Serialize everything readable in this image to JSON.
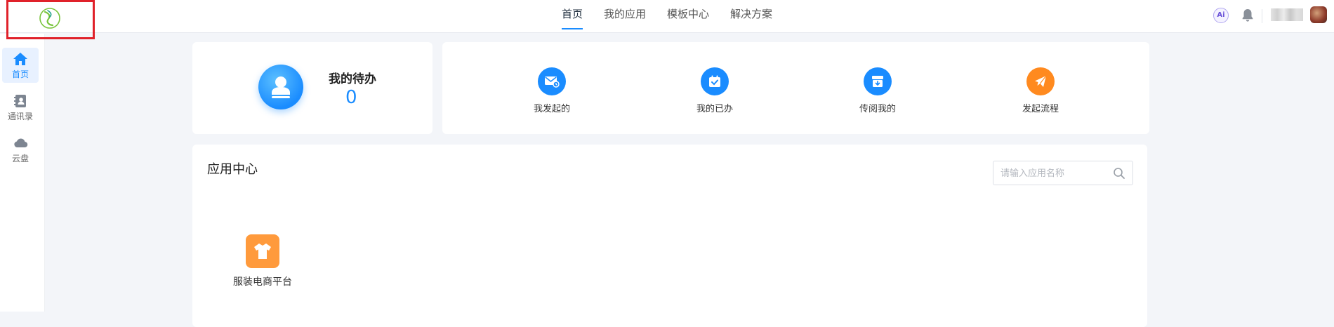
{
  "nav": {
    "items": [
      "首页",
      "我的应用",
      "模板中心",
      "解决方案"
    ],
    "active": 0
  },
  "header": {
    "ai_label": "Ai"
  },
  "sidebar": {
    "items": [
      {
        "label": "首页",
        "icon": "home-icon",
        "active": true
      },
      {
        "label": "通讯录",
        "icon": "contacts-icon"
      },
      {
        "label": "云盘",
        "icon": "cloud-icon"
      }
    ]
  },
  "todo": {
    "title": "我的待办",
    "count": "0"
  },
  "quick_actions": [
    {
      "label": "我发起的",
      "icon": "mail-icon",
      "color": "#1a8cff"
    },
    {
      "label": "我的已办",
      "icon": "calendar-check-icon",
      "color": "#1a8cff"
    },
    {
      "label": "传阅我的",
      "icon": "archive-download-icon",
      "color": "#1a8cff"
    },
    {
      "label": "发起流程",
      "icon": "paper-plane-icon",
      "color": "#ff8a1f"
    }
  ],
  "app_center": {
    "title": "应用中心",
    "search": {
      "placeholder": "请输入应用名称",
      "value": ""
    },
    "apps": [
      {
        "label": "服装电商平台",
        "icon": "shirt-icon",
        "color": "#ff9a3c"
      }
    ]
  },
  "colors": {
    "accent": "#1a8cff",
    "orange": "#ff8a1f",
    "highlight_border": "#e0212a"
  }
}
